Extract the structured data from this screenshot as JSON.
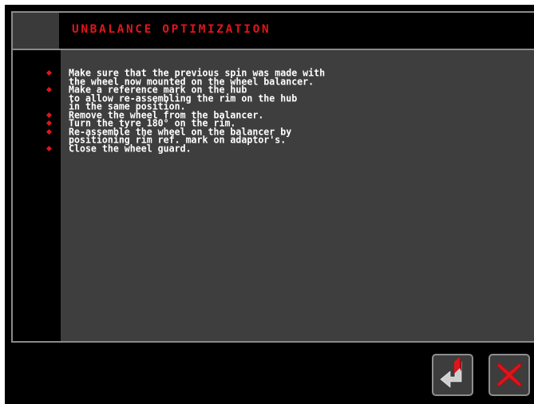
{
  "header": {
    "title": "UNBALANCE OPTIMIZATION"
  },
  "instructions": [
    {
      "lines": [
        "Make sure that the previous spin was made with",
        "the wheel now mounted on the wheel balancer."
      ]
    },
    {
      "lines": [
        "Make a reference mark on the hub",
        "to allow re-assembling the rim on the hub",
        "in the same position."
      ]
    },
    {
      "lines": [
        "Remove the wheel from the balancer."
      ]
    },
    {
      "lines": [
        "Turn the tyre 180° on the rim."
      ]
    },
    {
      "lines": [
        "Re-assemble the wheel on the balancer by",
        "positioning rim ref. mark on adaptor's."
      ]
    },
    {
      "lines": [
        "Close the wheel guard."
      ]
    }
  ],
  "footer": {
    "confirm_icon": "enter-return-icon",
    "cancel_icon": "close-x-icon"
  },
  "colors": {
    "accent": "#e0151c",
    "panel": "#3e3e3e",
    "background": "#000000",
    "border": "#8a8a8a"
  }
}
